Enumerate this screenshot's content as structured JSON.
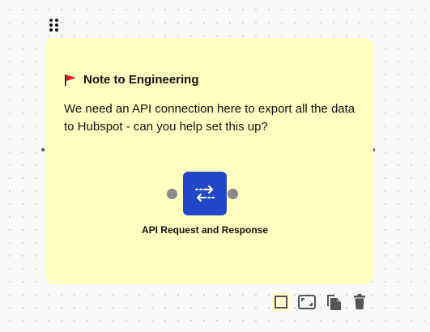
{
  "note": {
    "title": "Note to Engineering",
    "title_icon": "red-flag-icon",
    "body": "We need an API connection here to export all the data to Hubspot - can you help set this up?",
    "background": "#ffffc2"
  },
  "node": {
    "label": "API Request and Response",
    "icon": "arrows-exchange-icon",
    "color": "#2347c9"
  },
  "toolbar": {
    "icons": [
      "square-icon",
      "resize-icon",
      "duplicate-icon",
      "trash-icon"
    ]
  }
}
